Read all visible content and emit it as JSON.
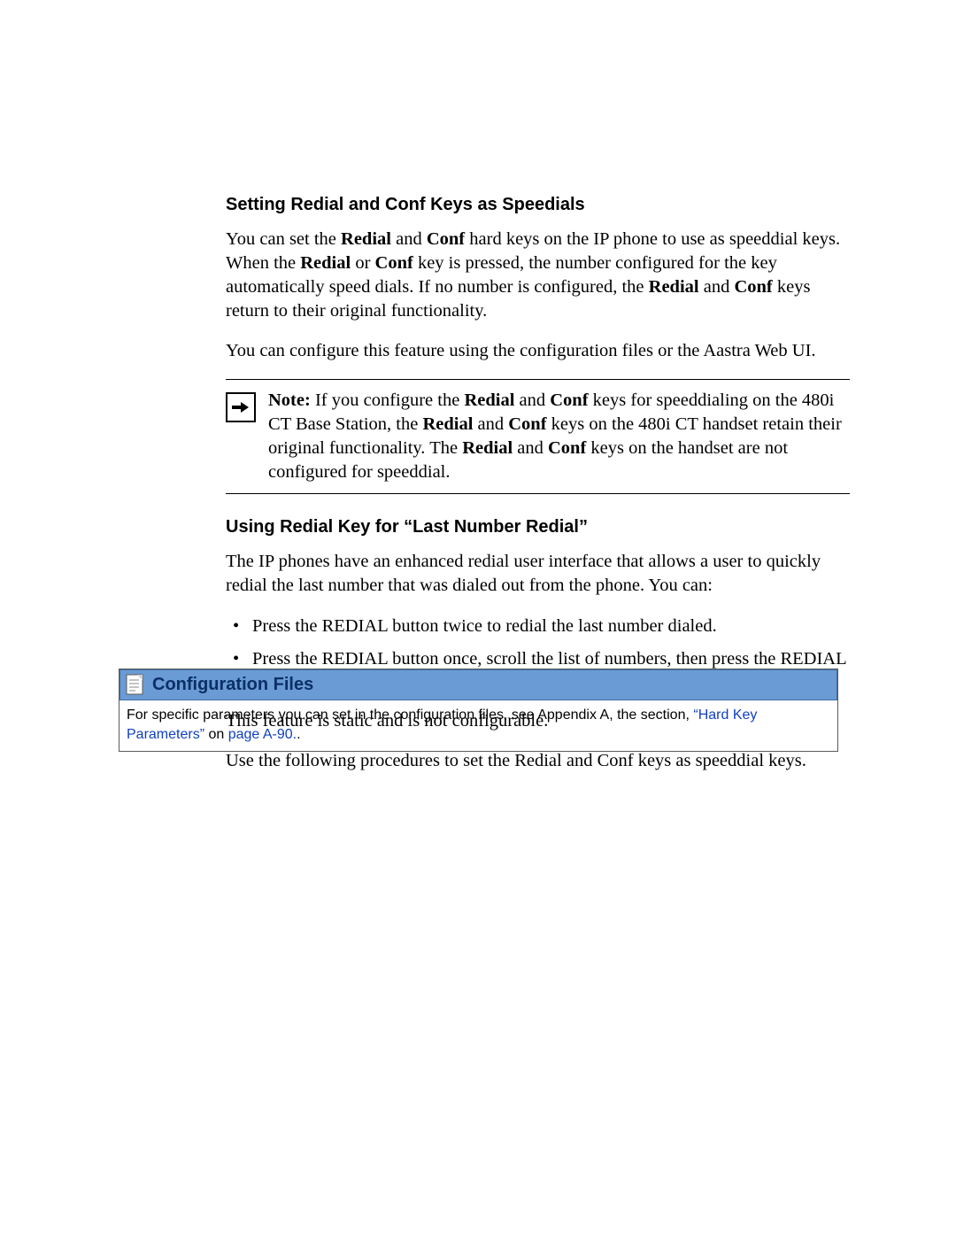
{
  "section1": {
    "heading": "Setting Redial and Conf Keys as Speedials",
    "para1_pre": "You can set the ",
    "b_redial": "Redial",
    "and": " and ",
    "b_conf": "Conf",
    "para1_mid": " hard keys on the IP phone to use as speeddial keys. When the ",
    "b_redial2": "Redial",
    "or": " or ",
    "b_conf2": "Conf",
    "para1_mid2": " key is pressed, the number configured for the key automatically speed dials. If no number is configured, the ",
    "b_redial3": "Redial",
    "and2": " and ",
    "b_conf3": "Conf",
    "para1_end": " keys return to their original functionality.",
    "para2": "You can configure this feature using the configuration files or the Aastra Web UI."
  },
  "note": {
    "label": "Note:",
    "t1": " If you configure the ",
    "b_redial": "Redial",
    "and": " and ",
    "b_conf": "Conf",
    "t2": " keys for speeddialing on the 480i CT Base Station, the ",
    "b_redial2": "Redial",
    "and2": " and ",
    "b_conf2": "Conf",
    "t3": " keys on the 480i CT handset retain their original functionality. The ",
    "b_redial3": "Redial",
    "and3": " and ",
    "b_conf3": "Conf",
    "t4": " keys on the handset are not configured for speeddial."
  },
  "section2": {
    "heading": "Using Redial Key for “Last Number Redial”",
    "para1": "The IP phones have an enhanced redial user interface that allows a user to quickly redial the last number that was dialed out from the phone. You can:",
    "bullets": [
      "Press the REDIAL button twice to redial the last number dialed.",
      "Press the REDIAL button once, scroll the list of numbers, then press the REDIAL button again to dial the number that displays on the screen."
    ],
    "para2": "This feature is static and is not configurable.",
    "para3": "Use the following procedures to set the Redial and Conf keys as speeddial keys."
  },
  "configbox": {
    "title": "Configuration Files",
    "body_pre": "For specific parameters you can set in the configuration files, see Appendix A, the section, ",
    "link1": "“Hard Key Parameters”",
    "body_mid": " on ",
    "link2": "page A-90.",
    "body_end": "."
  }
}
